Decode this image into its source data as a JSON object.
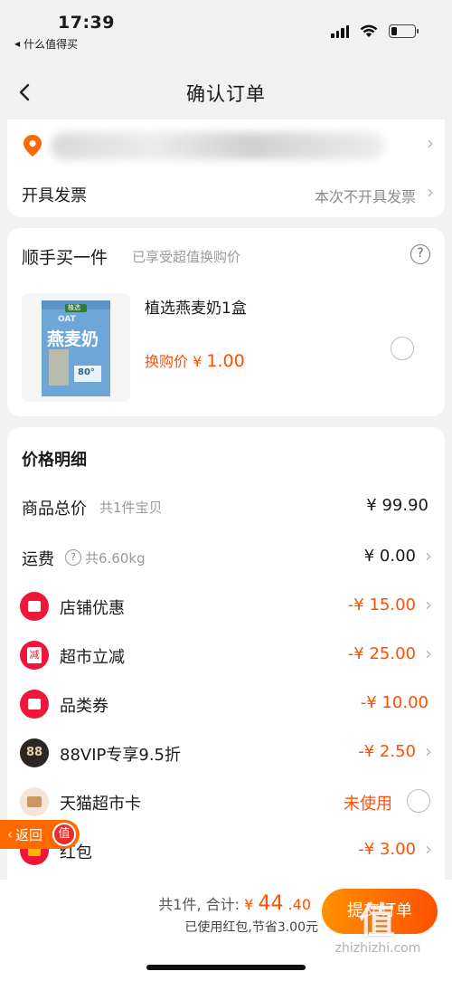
{
  "status_bar": {
    "time": "17:39",
    "back_app": "什么值得买"
  },
  "nav": {
    "title": "确认订单"
  },
  "address": {
    "invoice_label": "开具发票",
    "invoice_value": "本次不开具发票"
  },
  "addon": {
    "title": "顺手买一件",
    "subtitle": "已享受超值换购价",
    "help": "?",
    "product_name": "植选燕麦奶1盒",
    "price_label": "换购价",
    "price_currency": "¥",
    "price_amount": "1.00",
    "product_brand": "植选",
    "product_text": "燕麦奶",
    "product_oat": "OAT",
    "product_badge": "80°"
  },
  "price_detail": {
    "title": "价格明细",
    "rows": [
      {
        "label": "商品总价",
        "sub": "共1件宝贝",
        "value": "¥ 99.90"
      },
      {
        "label": "运费",
        "sub": "共6.60kg",
        "value": "¥ 0.00"
      },
      {
        "label": "店铺优惠",
        "value": "-¥ 15.00"
      },
      {
        "label": "超市立减",
        "value": "-¥ 25.00",
        "icon_text": "减"
      },
      {
        "label": "品类券",
        "value": "-¥ 10.00"
      },
      {
        "label": "88VIP专享9.5折",
        "value": "-¥ 2.50",
        "icon_text": "88"
      },
      {
        "label": "天猫超市卡",
        "value": "未使用"
      },
      {
        "label": "红包",
        "value": "-¥ 3.00"
      }
    ]
  },
  "floating": {
    "back_label": "返回",
    "badge": "值"
  },
  "bottom": {
    "count_label": "共1件,",
    "total_label": "合计:",
    "total_currency": "¥",
    "total_amount": "44",
    "total_decimal": ".40",
    "saved_text": "已使用红包,节省3.00元",
    "submit_label": "提交订单"
  },
  "watermark": {
    "big": "值",
    "domain": "zhizhizhi.com"
  },
  "colors": {
    "accent": "#ff5000",
    "coupon_red": "#f0163a",
    "vip_dark": "#2b2623"
  }
}
